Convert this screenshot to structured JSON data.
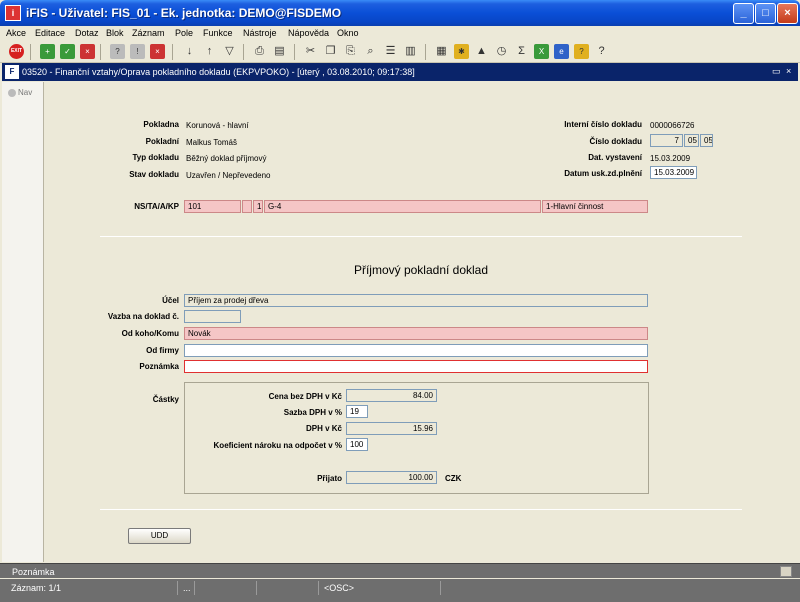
{
  "window": {
    "title": "iFIS - Uživatel: FIS_01 - Ek. jednotka: DEMO@FISDEMO",
    "minimize": "_",
    "maximize": "□",
    "close": "×"
  },
  "menu": [
    "Akce",
    "Editace",
    "Dotaz",
    "Blok",
    "Záznam",
    "Pole",
    "Funkce",
    "Nástroje",
    "Nápověda",
    "Okno"
  ],
  "toolbar": {
    "exit_label": "EXIT"
  },
  "inner_window": {
    "title": "03520 - Finanční vztahy/Oprava pokladního dokladu (EKPVPOKO) - [úterý , 03.08.2010; 09:17:38]",
    "restore": "▭",
    "close": "×"
  },
  "nav": {
    "label": "Nav"
  },
  "header": {
    "pokladna_label": "Pokladna",
    "pokladna_value": "Korunová - hlavní",
    "pokladni_label": "Pokladní",
    "pokladni_value": "Malkus Tomáš",
    "typ_label": "Typ dokladu",
    "typ_value": "Běžný doklad příjmový",
    "stav_label": "Stav dokladu",
    "stav_value": "Uzavřen / Nepřevedeno",
    "interni_label": "Interní číslo dokladu",
    "interni_value": "0000066726",
    "cislo_label": "Číslo dokladu",
    "cislo_parts": [
      "7",
      "05",
      "05"
    ],
    "dat_vyst_label": "Dat. vystavení",
    "dat_vyst_value": "15.03.2009",
    "datum_usk_label": "Datum usk.zd.plnění",
    "datum_usk_value": "15.03.2009",
    "ns_label": "NS/TA/A/KP",
    "ns_fields": [
      "101",
      "",
      "1",
      "G-4",
      "1-Hlavní činnost"
    ]
  },
  "doc": {
    "heading": "Příjmový pokladní doklad",
    "ucel_label": "Účel",
    "ucel_value": "Příjem za prodej dřeva",
    "vazba_label": "Vazba na doklad č.",
    "vazba_value": "",
    "odkoho_label": "Od koho/Komu",
    "odkoho_value": "Novák",
    "odfirmy_label": "Od firmy",
    "odfirmy_value": "",
    "poznamka_label": "Poznámka",
    "poznamka_value": ""
  },
  "amounts": {
    "section_label": "Částky",
    "cena_label": "Cena bez DPH v Kč",
    "cena_value": "84.00",
    "sazba_label": "Sazba DPH v %",
    "sazba_value": "19",
    "dph_label": "DPH v Kč",
    "dph_value": "15.96",
    "koef_label": "Koeficient nároku na odpočet v %",
    "koef_value": "100",
    "prijato_label": "Přijato",
    "prijato_value": "100.00",
    "currency": "CZK"
  },
  "buttons": {
    "udd": "UDD"
  },
  "status": {
    "note": "Poznámka",
    "record": "Záznam: 1/1",
    "dots": "...",
    "osc": "<OSC>"
  }
}
